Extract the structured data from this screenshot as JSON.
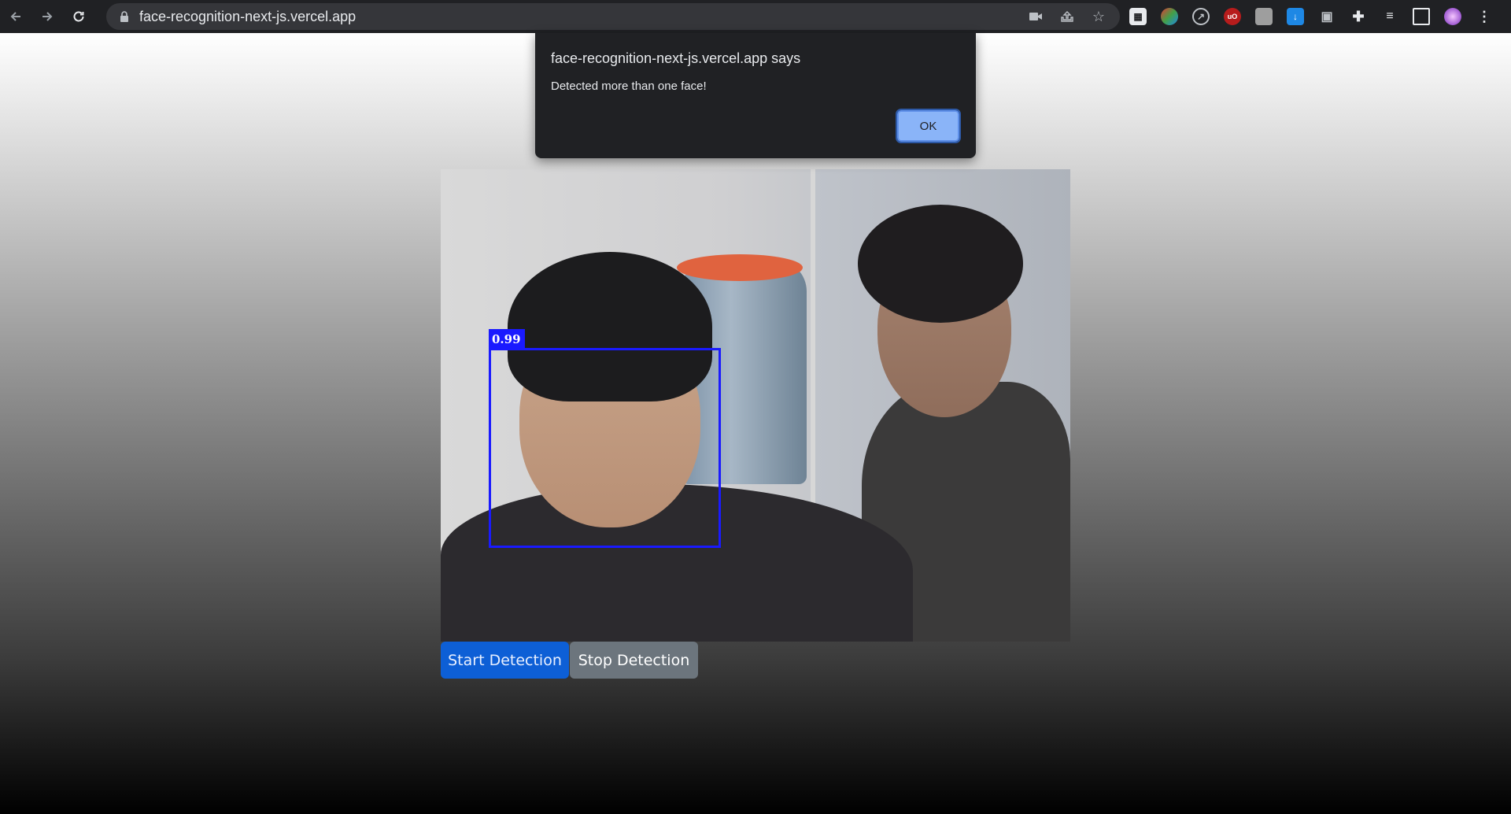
{
  "browser": {
    "url": "face-recognition-next-js.vercel.app",
    "nav_icons": [
      "back-icon",
      "forward-icon",
      "reload-icon"
    ]
  },
  "dialog": {
    "title": "face-recognition-next-js.vercel.app says",
    "message": "Detected more than one face!",
    "ok_label": "OK"
  },
  "detection": {
    "confidence": "0.99",
    "box_color": "#1a1aff"
  },
  "controls": {
    "start_label": "Start Detection",
    "stop_label": "Stop Detection"
  },
  "colors": {
    "start_button": "#0d5fd6",
    "stop_button": "#6c757d"
  }
}
